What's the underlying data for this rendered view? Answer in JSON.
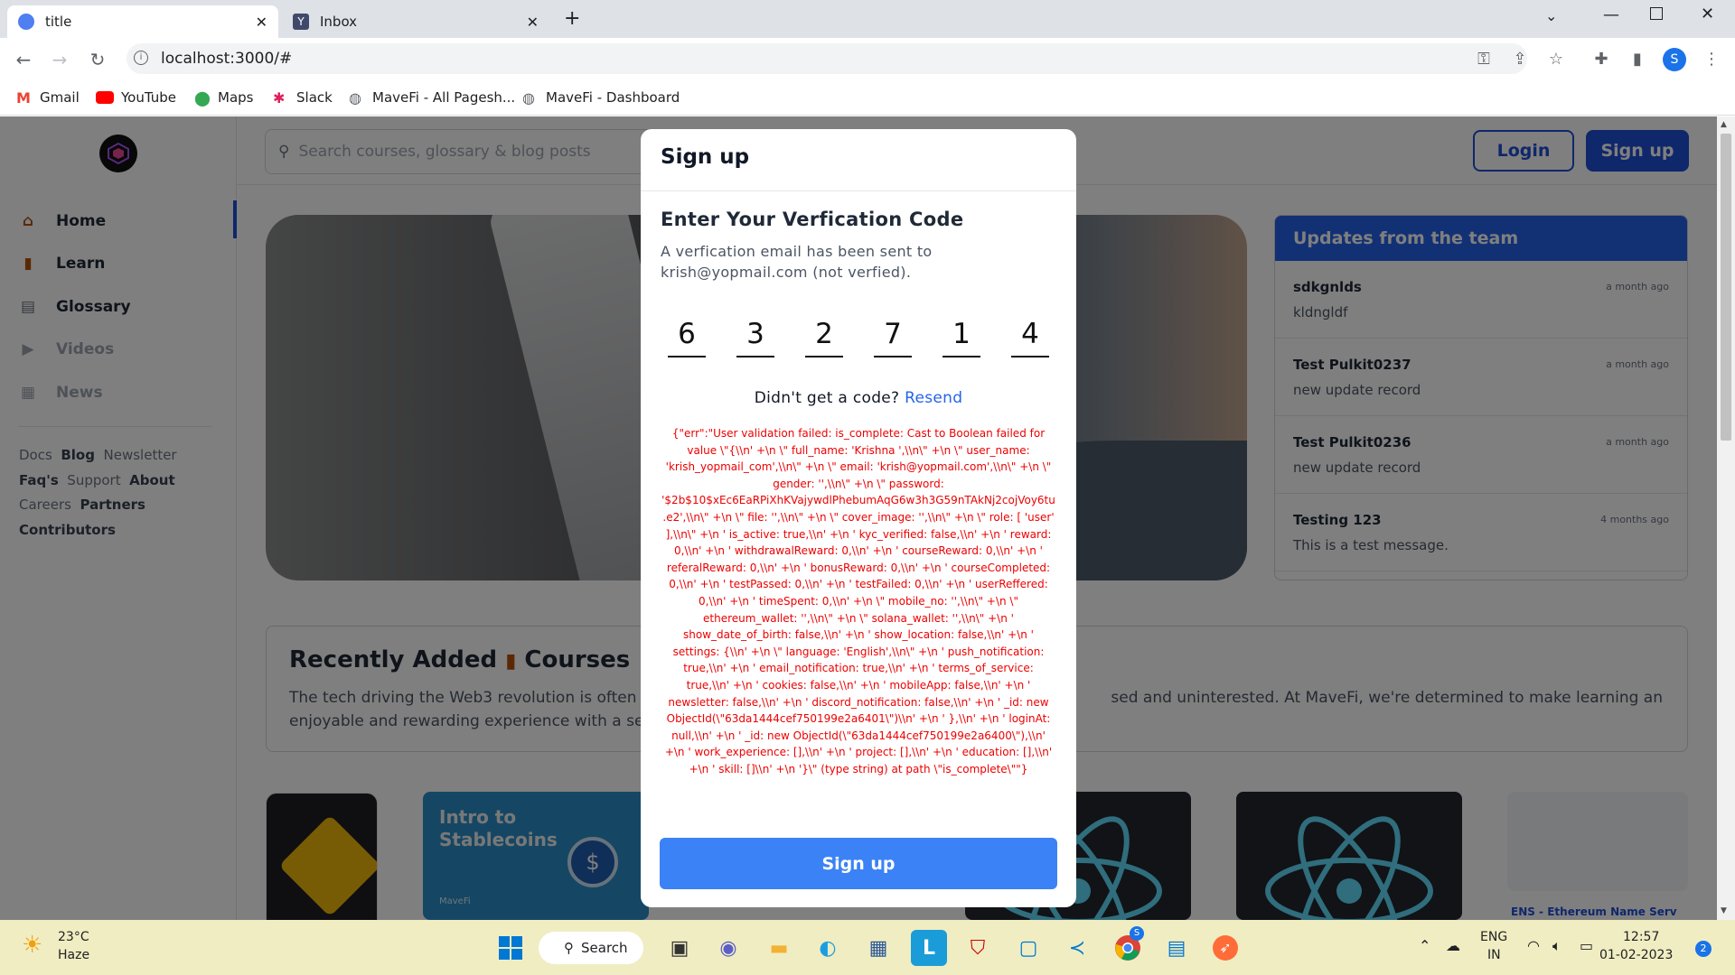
{
  "browser": {
    "tabs": [
      {
        "title": "title",
        "icon": "app-favicon-icon"
      },
      {
        "title": "Inbox",
        "icon": "yopmail-favicon-icon"
      }
    ],
    "url": "localhost:3000/#",
    "profile_initial": "S",
    "bookmarks": [
      {
        "label": "Gmail",
        "icon": "gmail-icon"
      },
      {
        "label": "YouTube",
        "icon": "youtube-icon"
      },
      {
        "label": "Maps",
        "icon": "maps-icon"
      },
      {
        "label": "Slack",
        "icon": "slack-icon"
      },
      {
        "label": "MaveFi - All Pagesh...",
        "icon": "globe-icon"
      },
      {
        "label": "MaveFi - Dashboard",
        "icon": "globe-icon"
      }
    ]
  },
  "app": {
    "search_placeholder": "Search courses, glossary & blog posts",
    "login_label": "Login",
    "signup_label": "Sign up",
    "nav": [
      {
        "label": "Home",
        "icon": "home-icon"
      },
      {
        "label": "Learn",
        "icon": "book-icon"
      },
      {
        "label": "Glossary",
        "icon": "glossary-icon"
      },
      {
        "label": "Videos",
        "icon": "videos-icon"
      },
      {
        "label": "News",
        "icon": "news-icon"
      }
    ],
    "footer_links": [
      "Docs",
      "Blog",
      "Newsletter",
      "Faq's",
      "Support",
      "About",
      "Careers",
      "Partners",
      "Contributors"
    ],
    "updates": {
      "title": "Updates from the team",
      "items": [
        {
          "title": "sdkgnlds",
          "body": "kldngldf",
          "age": "a month ago"
        },
        {
          "title": "Test Pulkit0237",
          "body": "new update record",
          "age": "a month ago"
        },
        {
          "title": "Test Pulkit0236",
          "body": "new update record",
          "age": "a month ago"
        },
        {
          "title": "Testing 123",
          "body": "This is a test message.",
          "age": "4 months ago"
        }
      ]
    },
    "recent": {
      "title_pre": "Recently Added",
      "title_post": "Courses",
      "desc_left": "The tech driving the Web3 revolution is often",
      "desc_right": "sed and uninterested. At MaveFi, we're determined to make learning an",
      "desc_line2_left": "enjoyable and rewarding experience with a se"
    },
    "cards": {
      "stablecoin_title": "Intro to Stablecoins",
      "stablecoin_brand": "MaveFi",
      "ens_caption": "ENS - Ethereum Name Serv"
    }
  },
  "modal": {
    "title": "Sign up",
    "heading": "Enter Your Verfication Code",
    "description": "A verfication email has been sent to krish@yopmail.com (not verfied).",
    "code_digits": [
      "6",
      "3",
      "2",
      "7",
      "1",
      "4"
    ],
    "resend_prompt": "Didn't get a code?",
    "resend_label": "Resend",
    "error": "{\"err\":\"User validation failed: is_complete: Cast to Boolean failed for value \\\"{\\\\n' +\\n \\\" full_name: 'Krishna ',\\\\n\\\" +\\n \\\" user_name: 'krish_yopmail_com',\\\\n\\\" +\\n \\\" email: 'krish@yopmail.com',\\\\n\\\" +\\n \\\" gender: '',\\\\n\\\" +\\n \\\" password: '$2b$10$xEc6EaRPiXhKVajywdlPhebumAqG6w3h3G59nTAkNj2cojVoy6tu.e2',\\\\n\\\" +\\n \\\" file: '',\\\\n\\\" +\\n \\\" cover_image: '',\\\\n\\\" +\\n \\\" role: [ 'user' ],\\\\n\\\" +\\n ' is_active: true,\\\\n' +\\n ' kyc_verified: false,\\\\n' +\\n ' reward: 0,\\\\n' +\\n ' withdrawalReward: 0,\\\\n' +\\n ' courseReward: 0,\\\\n' +\\n ' referalReward: 0,\\\\n' +\\n ' bonusReward: 0,\\\\n' +\\n ' courseCompleted: 0,\\\\n' +\\n ' testPassed: 0,\\\\n' +\\n ' testFailed: 0,\\\\n' +\\n ' userReffered: 0,\\\\n' +\\n ' timeSpent: 0,\\\\n' +\\n \\\" mobile_no: '',\\\\n\\\" +\\n \\\" ethereum_wallet: '',\\\\n\\\" +\\n \\\" solana_wallet: '',\\\\n\\\" +\\n ' show_date_of_birth: false,\\\\n' +\\n ' show_location: false,\\\\n' +\\n ' settings: {\\\\n' +\\n \\\" language: 'English',\\\\n\\\" +\\n ' push_notification: true,\\\\n' +\\n ' email_notification: true,\\\\n' +\\n ' terms_of_service: true,\\\\n' +\\n ' cookies: false,\\\\n' +\\n ' mobileApp: false,\\\\n' +\\n ' newsletter: false,\\\\n' +\\n ' discord_notification: false,\\\\n' +\\n ' _id: new ObjectId(\\\"63da1444cef750199e2a6401\\\")\\\\n' +\\n ' },\\\\n' +\\n ' loginAt: null,\\\\n' +\\n ' _id: new ObjectId(\\\"63da1444cef750199e2a6400\\\"),\\\\n' +\\n ' work_experience: [],\\\\n' +\\n ' project: [],\\\\n' +\\n ' education: [],\\\\n' +\\n ' skill: []\\\\n' +\\n '}\\\" (type string) at path \\\"is_complete\\\"\"}",
    "button_label": "Sign up"
  },
  "taskbar": {
    "weather_temp": "23°C",
    "weather_desc": "Haze",
    "search_label": "Search",
    "lang": "ENG",
    "region": "IN",
    "time": "12:57",
    "date": "01-02-2023",
    "notification_count": "2",
    "chrome_badge": "S"
  },
  "colors": {
    "accent": "#2563eb",
    "error": "#e00000",
    "taskbar": "#f0edc2"
  }
}
